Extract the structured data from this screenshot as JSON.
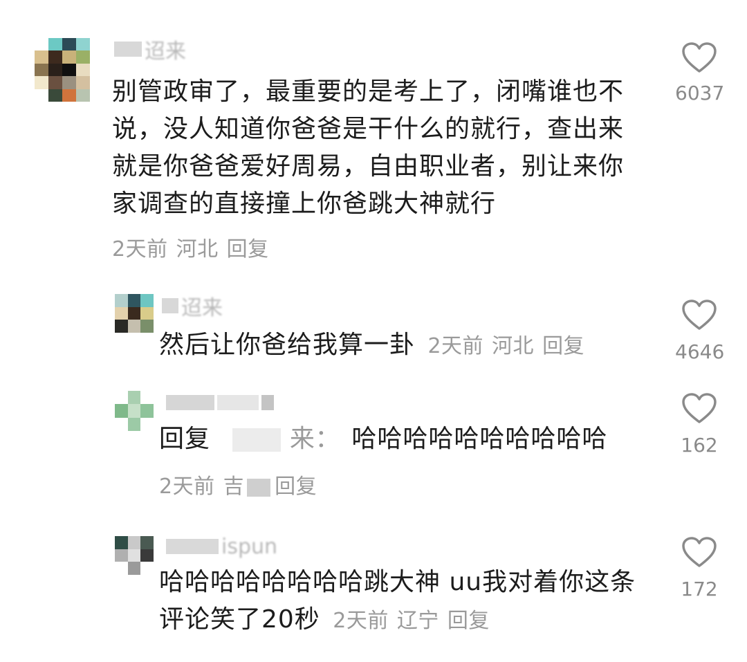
{
  "comments": [
    {
      "username": "迢来",
      "text": "别管政审了，最重要的是考上了，闭嘴谁也不说，没人知道你爸爸是干什么的就行，查出来就是你爸爸爱好周易，自由职业者，别让来你家调查的直接撞上你爸跳大神就行",
      "time": "2天前",
      "location": "河北",
      "reply_label": "回复",
      "likes": "6037"
    },
    {
      "username": "迢来",
      "text": "然后让你爸给我算一卦",
      "time": "2天前",
      "location": "河北",
      "reply_label": "回复",
      "likes": "4646"
    },
    {
      "username": "",
      "reply_prefix": "回复",
      "reply_target_tail": "来：",
      "text": "哈哈哈哈哈哈哈哈哈哈",
      "time": "2天前",
      "location": "吉",
      "reply_label": "回复",
      "likes": "162"
    },
    {
      "username": "ispun",
      "text": "哈哈哈哈哈哈哈哈跳大神 uu我对着你这条评论笑了20秒",
      "time": "2天前",
      "location": "辽宁",
      "reply_label": "回复",
      "likes": "172"
    }
  ],
  "icons": {
    "like": "heart-outline-icon"
  },
  "colors": {
    "text": "#1c1c1c",
    "meta": "#9a9a9a",
    "heart": "#8a8a8a"
  }
}
